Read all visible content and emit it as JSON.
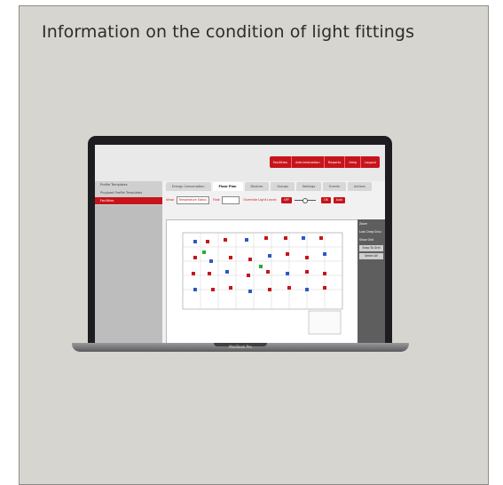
{
  "card": {
    "title": "Information on the condition of light fittings"
  },
  "laptop": {
    "model_label": "MacBook Pro"
  },
  "app": {
    "topnav": [
      "Facilities",
      "Administration",
      "Reports",
      "Help",
      "Logout"
    ],
    "sidebar": [
      "Profile Templates",
      "Plugload Profile Templates",
      "Facilities"
    ],
    "tabs": [
      "Energy Consumption",
      "Floor Plan",
      "Devices",
      "Groups",
      "Settings",
      "Events",
      "Actions"
    ],
    "toolbar": {
      "view_label": "View:",
      "view_value": "Temperature Status",
      "find_label": "Find:",
      "find_value": "",
      "override_label": "Override Light Level:",
      "override_value": "OFF",
      "ok_label": "OK",
      "auto_label": "Auto"
    },
    "right_panel": {
      "zoom_label": "Zoom",
      "lock_label": "Lock Drag Grou",
      "show_grid_label": "Show Grid",
      "snap_label": "Snap To Grid",
      "select_label": "Select All"
    }
  },
  "colors": {
    "accent": "#c7141b",
    "card_bg": "#d7d5cf"
  }
}
